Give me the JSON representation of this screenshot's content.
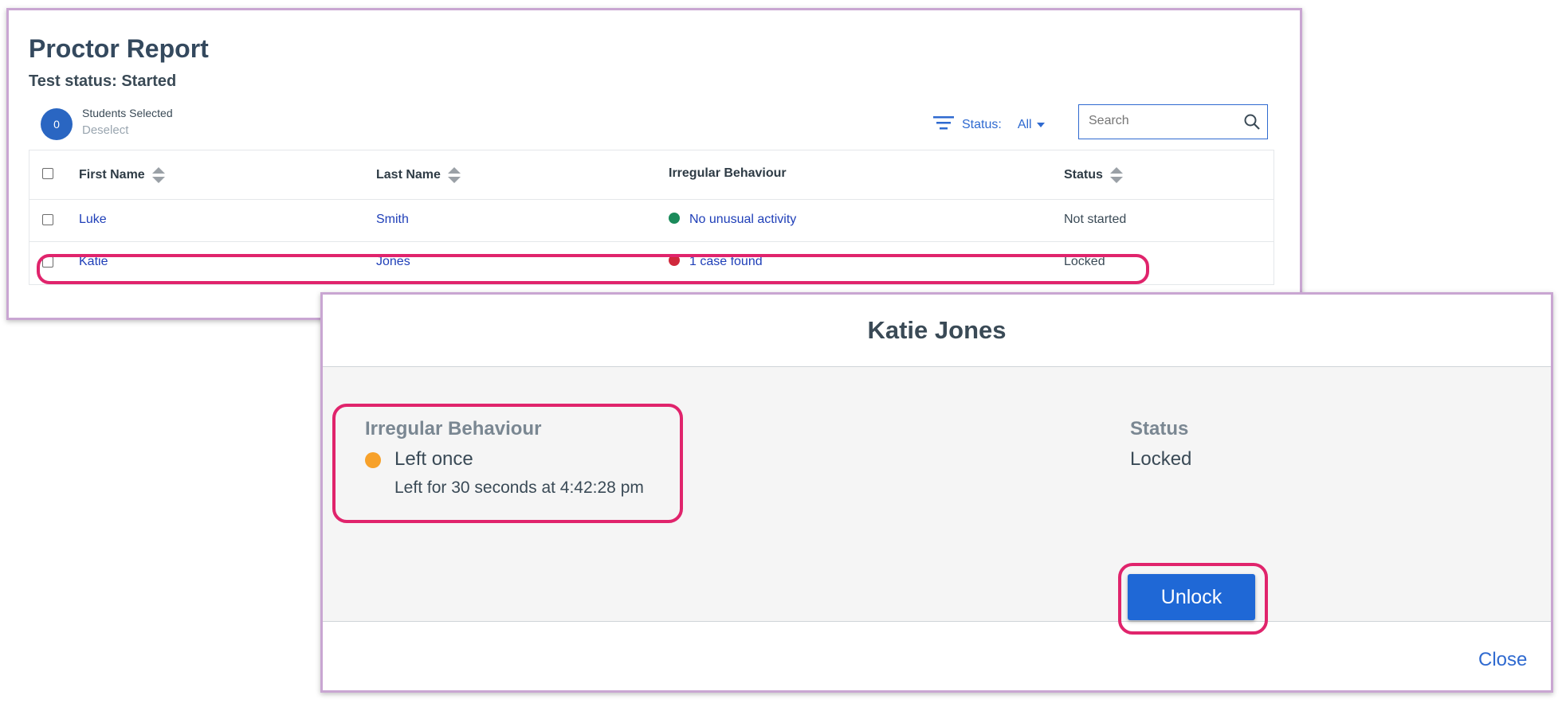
{
  "report": {
    "title": "Proctor Report",
    "subtitle": "Test status: Started",
    "selected_count": "0",
    "selected_label": "Students Selected",
    "deselect_label": "Deselect",
    "filter_label": "Status:",
    "filter_value": "All",
    "search_placeholder": "Search",
    "columns": [
      "First Name",
      "Last Name",
      "Irregular Behaviour",
      "Status"
    ],
    "rows": [
      {
        "first": "Luke",
        "last": "Smith",
        "behaviour": "No unusual activity",
        "behaviour_color": "#1a8a5a",
        "status": "Not started"
      },
      {
        "first": "Katie",
        "last": "Jones",
        "behaviour": "1 case found",
        "behaviour_color": "#d0283c",
        "status": "Locked"
      }
    ]
  },
  "modal": {
    "title": "Katie Jones",
    "behaviour_label": "Irregular Behaviour",
    "behaviour_value": "Left once",
    "behaviour_color": "#f7a12a",
    "behaviour_detail": "Left for 30 seconds at 4:42:28 pm",
    "status_label": "Status",
    "status_value": "Locked",
    "unlock_label": "Unlock",
    "close_label": "Close"
  },
  "colors": {
    "accent": "#1f68d6",
    "highlight": "#e0246c"
  }
}
